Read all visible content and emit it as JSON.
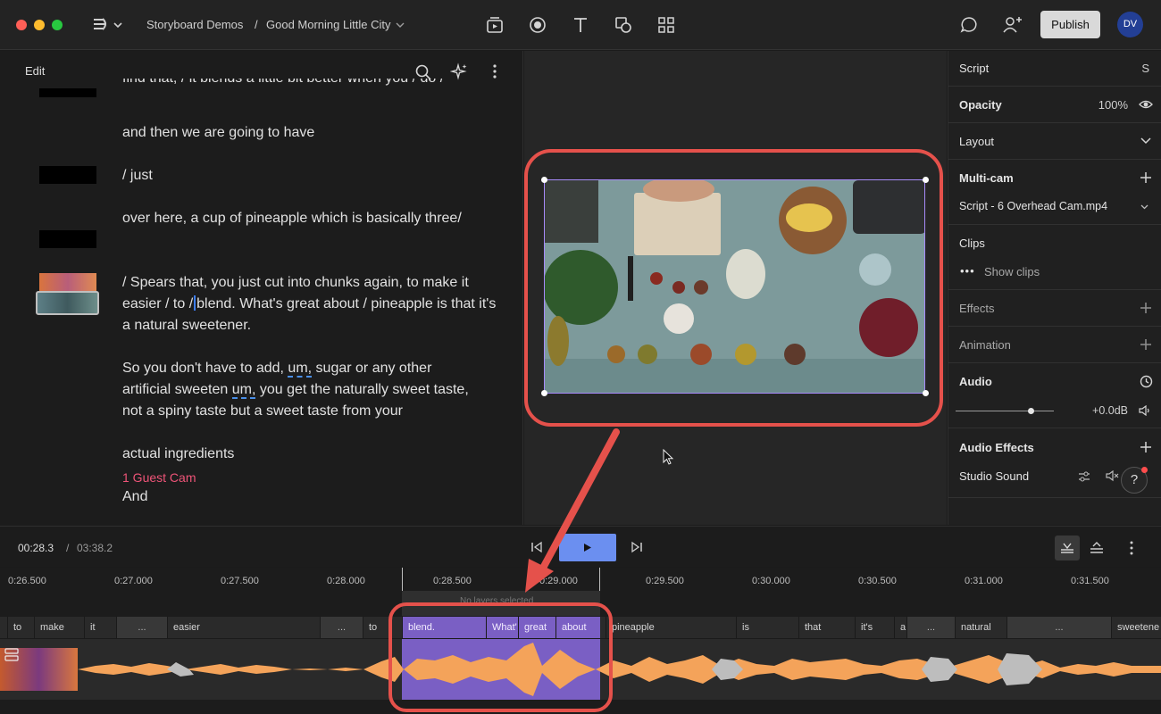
{
  "topbar": {
    "breadcrumb_project": "Storyboard Demos",
    "breadcrumb_sep": "/",
    "breadcrumb_file": "Good Morning Little City",
    "publish_label": "Publish",
    "avatar_initials": "DV"
  },
  "script": {
    "header_label": "Edit",
    "lines": {
      "top_cut": "find that, / it blends a little bit better when you / do /",
      "p1": "and then we are going to have",
      "p2": "/ just",
      "p3": "over here, a cup of pineapple which is basically three/",
      "p4a": "/ Spears that, you just cut into chunks again, to make it easier / to /",
      "p4b": "blend. What's great about / pineapple is that it's a natural sweetener.",
      "p5a": "So you don't have to add,",
      "p5_um1": "um,",
      "p5b": "sugar or any other artificial sweeten",
      "p5_um2": "um,",
      "p5c": "you get the naturally sweet taste, not a spiny taste but a sweet taste from your",
      "p6": "actual ingredients",
      "speaker": "1 Guest Cam",
      "p7": "And"
    }
  },
  "props": {
    "script_label": "Script",
    "script_shortcut": "S",
    "opacity_label": "Opacity",
    "opacity_value": "100%",
    "layout_label": "Layout",
    "multicam_label": "Multi-cam",
    "multicam_source": "Script - 6 Overhead Cam.mp4",
    "clips_label": "Clips",
    "show_clips": "Show clips",
    "effects_label": "Effects",
    "animation_label": "Animation",
    "audio_label": "Audio",
    "audio_gain": "+0.0dB",
    "audio_effects_label": "Audio Effects",
    "studio_sound": "Studio Sound"
  },
  "transport": {
    "current_time": "00:28.3",
    "separator": "/",
    "duration": "03:38.2"
  },
  "timeline": {
    "ruler": [
      "0:26.500",
      "0:27.000",
      "0:27.500",
      "0:28.000",
      "0:28.500",
      "0:29.000",
      "0:29.500",
      "0:30.000",
      "0:30.500",
      "0:31.000",
      "0:31.500"
    ],
    "selection_note": "No layers selected",
    "words": [
      "to",
      "make",
      "it",
      "...",
      "easier",
      "...",
      "to",
      "blend.",
      "What'",
      "great",
      "about",
      "pineapple",
      "is",
      "that",
      "it's",
      "a",
      "...",
      "natural",
      "...",
      "sweetene"
    ]
  },
  "colors": {
    "accent_blue": "#6b8ff0",
    "selection_purple": "#7a5fc4",
    "waveform_orange": "#f4a35a",
    "annotation_red": "#e5514b",
    "speaker_pink": "#ef5478"
  }
}
